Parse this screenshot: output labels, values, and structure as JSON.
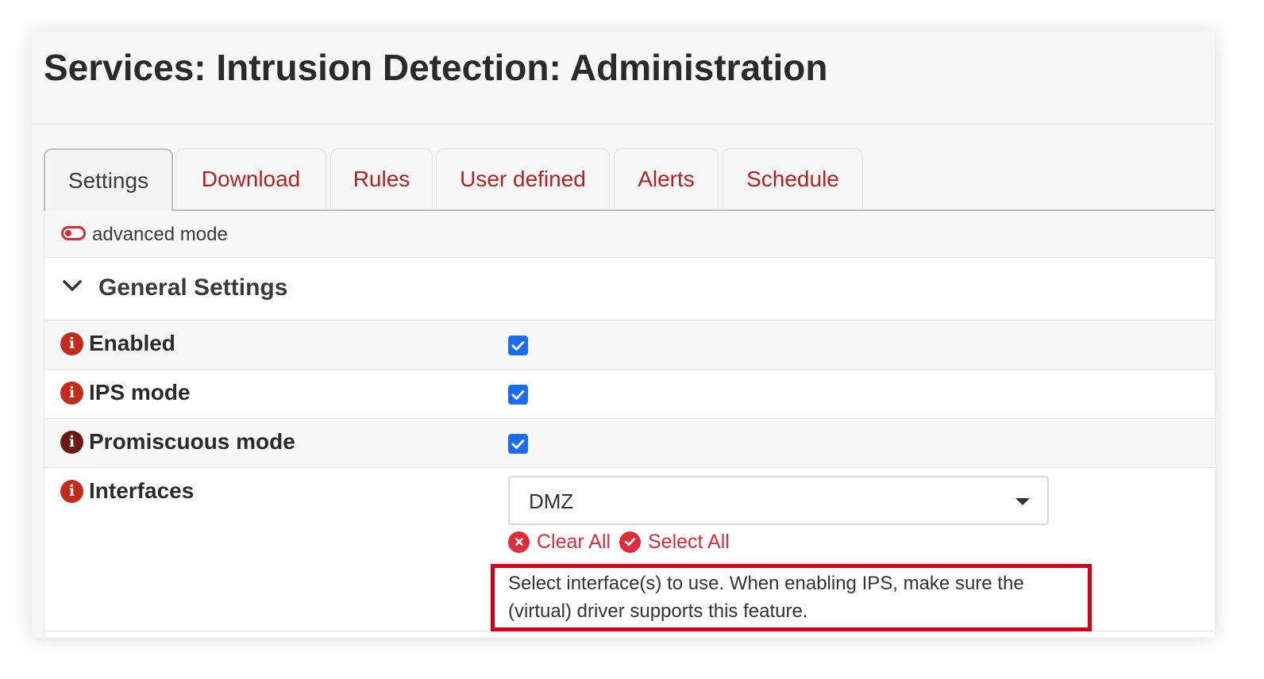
{
  "page": {
    "title": "Services: Intrusion Detection: Administration"
  },
  "tabs": [
    {
      "label": "Settings",
      "active": true
    },
    {
      "label": "Download",
      "active": false
    },
    {
      "label": "Rules",
      "active": false
    },
    {
      "label": "User defined",
      "active": false
    },
    {
      "label": "Alerts",
      "active": false
    },
    {
      "label": "Schedule",
      "active": false
    }
  ],
  "advanced_mode": {
    "label": "advanced mode",
    "enabled": false
  },
  "section": {
    "title": "General Settings",
    "expanded": true,
    "icon": "chevron-down-icon"
  },
  "fields": {
    "enabled": {
      "label": "Enabled",
      "checked": true,
      "icon": "info-icon"
    },
    "ips_mode": {
      "label": "IPS mode",
      "checked": true,
      "icon": "info-icon"
    },
    "promiscuous_mode": {
      "label": "Promiscuous mode",
      "checked": true,
      "icon": "info-icon"
    },
    "interfaces": {
      "label": "Interfaces",
      "icon": "info-icon",
      "selected": "DMZ",
      "clear_all": "Clear All",
      "select_all": "Select All",
      "help": "Select interface(s) to use. When enabling IPS, make sure the (virtual) driver supports this feature."
    }
  },
  "colors": {
    "accent": "#b8201f",
    "checkbox": "#1a6cf2",
    "action": "#e02b3a",
    "highlight_border": "#d0021b"
  }
}
